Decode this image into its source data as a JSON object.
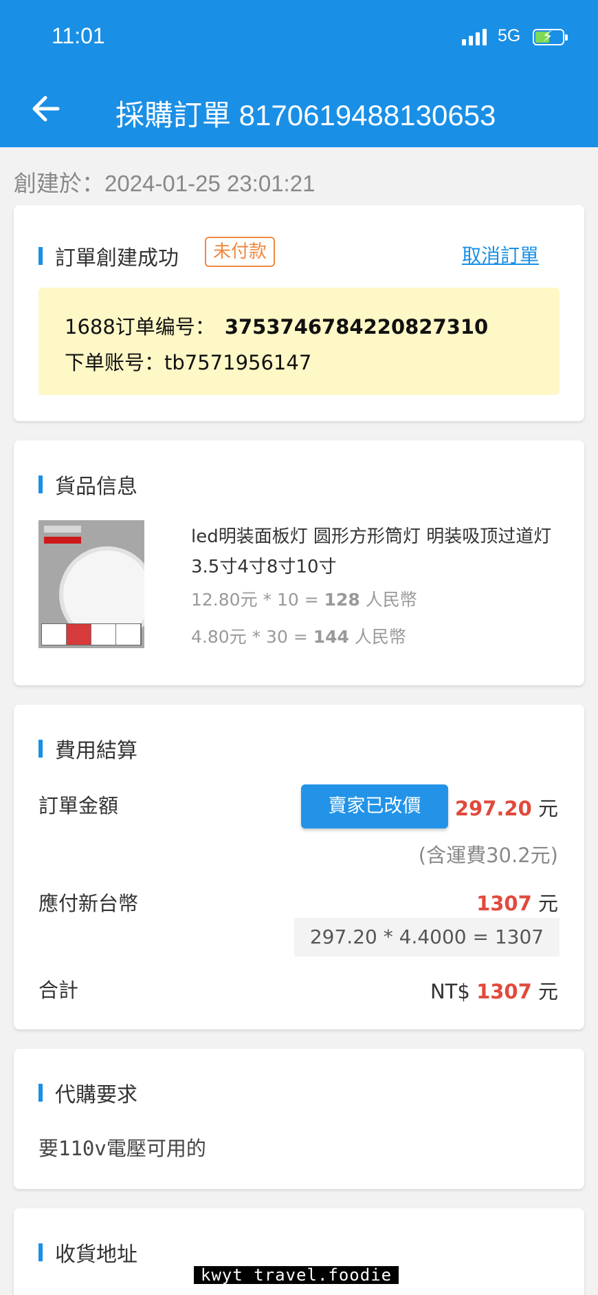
{
  "status_bar": {
    "time": "11:01",
    "network": "5G"
  },
  "nav": {
    "title": "採購訂單 8170619488130653"
  },
  "created_at": "創建於：2024-01-25 23:01:21",
  "order_status": {
    "title": "訂單創建成功",
    "badge": "未付款",
    "cancel_label": "取消訂單",
    "order_no_label": "1688订单编号：",
    "order_no": "3753746784220827310",
    "account_line": "下单账号：tb7571956147"
  },
  "goods": {
    "title": "貨品信息",
    "product_name": "led明装面板灯 圆形方形筒灯 明装吸顶过道灯3.5寸4寸8寸10寸",
    "lines": [
      {
        "unit_expr": "12.80元 * 10 = ",
        "total": "128",
        "currency": " 人民幣"
      },
      {
        "unit_expr": "4.80元 * 30 = ",
        "total": "144",
        "currency": " 人民幣"
      }
    ]
  },
  "cost": {
    "title": "費用結算",
    "order_amount_label": "訂單金額",
    "price_changed_button": "賣家已改價",
    "order_amount": "297.20",
    "unit": " 元",
    "freight_note": "(含運費30.2元)",
    "ntd_label": "應付新台幣",
    "ntd_amount": "1307",
    "calc": "297.20 * 4.4000 = 1307",
    "total_label": "合計",
    "total_prefix": "NT$ ",
    "total_amount": "1307"
  },
  "requirement": {
    "title": "代購要求",
    "text_latin": "要110v",
    "text_rest": "電壓可用的"
  },
  "address": {
    "title": "收貨地址"
  },
  "watermark": "kwyt travel.foodie",
  "colors": {
    "primary": "#1a8fe6",
    "accent_red": "#e04a3c",
    "badge_orange": "#f0883e",
    "highlight_yellow": "#fef7c6"
  }
}
